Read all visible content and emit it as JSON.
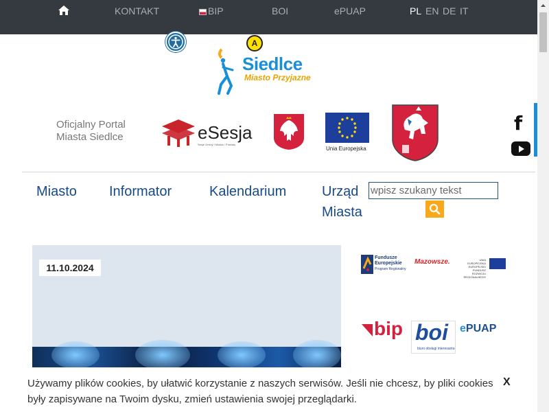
{
  "topbar": {
    "home_icon": "home-icon",
    "items": [
      "KONTAKT",
      "BIP",
      "BOI",
      "ePUAP"
    ],
    "languages": [
      "PL",
      "EN",
      "DE",
      "IT"
    ],
    "active_language": "PL"
  },
  "accessibility": {
    "accessibility_icon": "accessibility-icon",
    "contrast_label": "A"
  },
  "logo": {
    "name": "Siedlce",
    "tagline": "Miasto Przyjazne"
  },
  "portal": {
    "title_line1": "Oficjalny Portal",
    "title_line2": "Miasta Siedlce",
    "esesja": "eSesja",
    "esesja_sub": "Sesje Gminy i Miasta / Powiatu",
    "eu_label": "Unia Europejska"
  },
  "social": {
    "facebook_icon": "facebook-icon",
    "youtube_icon": "youtube-icon"
  },
  "nav": {
    "items": [
      "Miasto",
      "Informator",
      "Kalendarium",
      "Urząd Miasta"
    ]
  },
  "search": {
    "placeholder": "wpisz szukany tekst",
    "button_icon": "search-icon"
  },
  "news": {
    "date": "11.10.2024"
  },
  "partners": {
    "fe_line1": "Fundusze",
    "fe_line2": "Europejskie",
    "fe_line3": "Program Regionalny",
    "mazowsze": "Mazowsze.",
    "ue_text": "UNIA EUROPEJSKA EUROPEJSKI FUNDUSZ ROZWOJU REGIONALNEGO",
    "bip": "bip",
    "boi": "boi",
    "boi_sub": "biuro obsługi interesanta",
    "epuap_e": "e",
    "epuap_rest": "PUAP"
  },
  "cookie": {
    "text": "Używamy plików cookies, by ułatwić korzystanie z naszych serwisów. Jeśli nie chcesz, by pliki cookies były zapisywane na Twoim dysku, zmień ustawienia swojej przeglądarki.",
    "close_label": "X"
  },
  "colors": {
    "topbar": "#343a40",
    "nav_text": "#174a85",
    "accent_orange": "#f7a81b",
    "accent_blue": "#1b8fd6"
  }
}
